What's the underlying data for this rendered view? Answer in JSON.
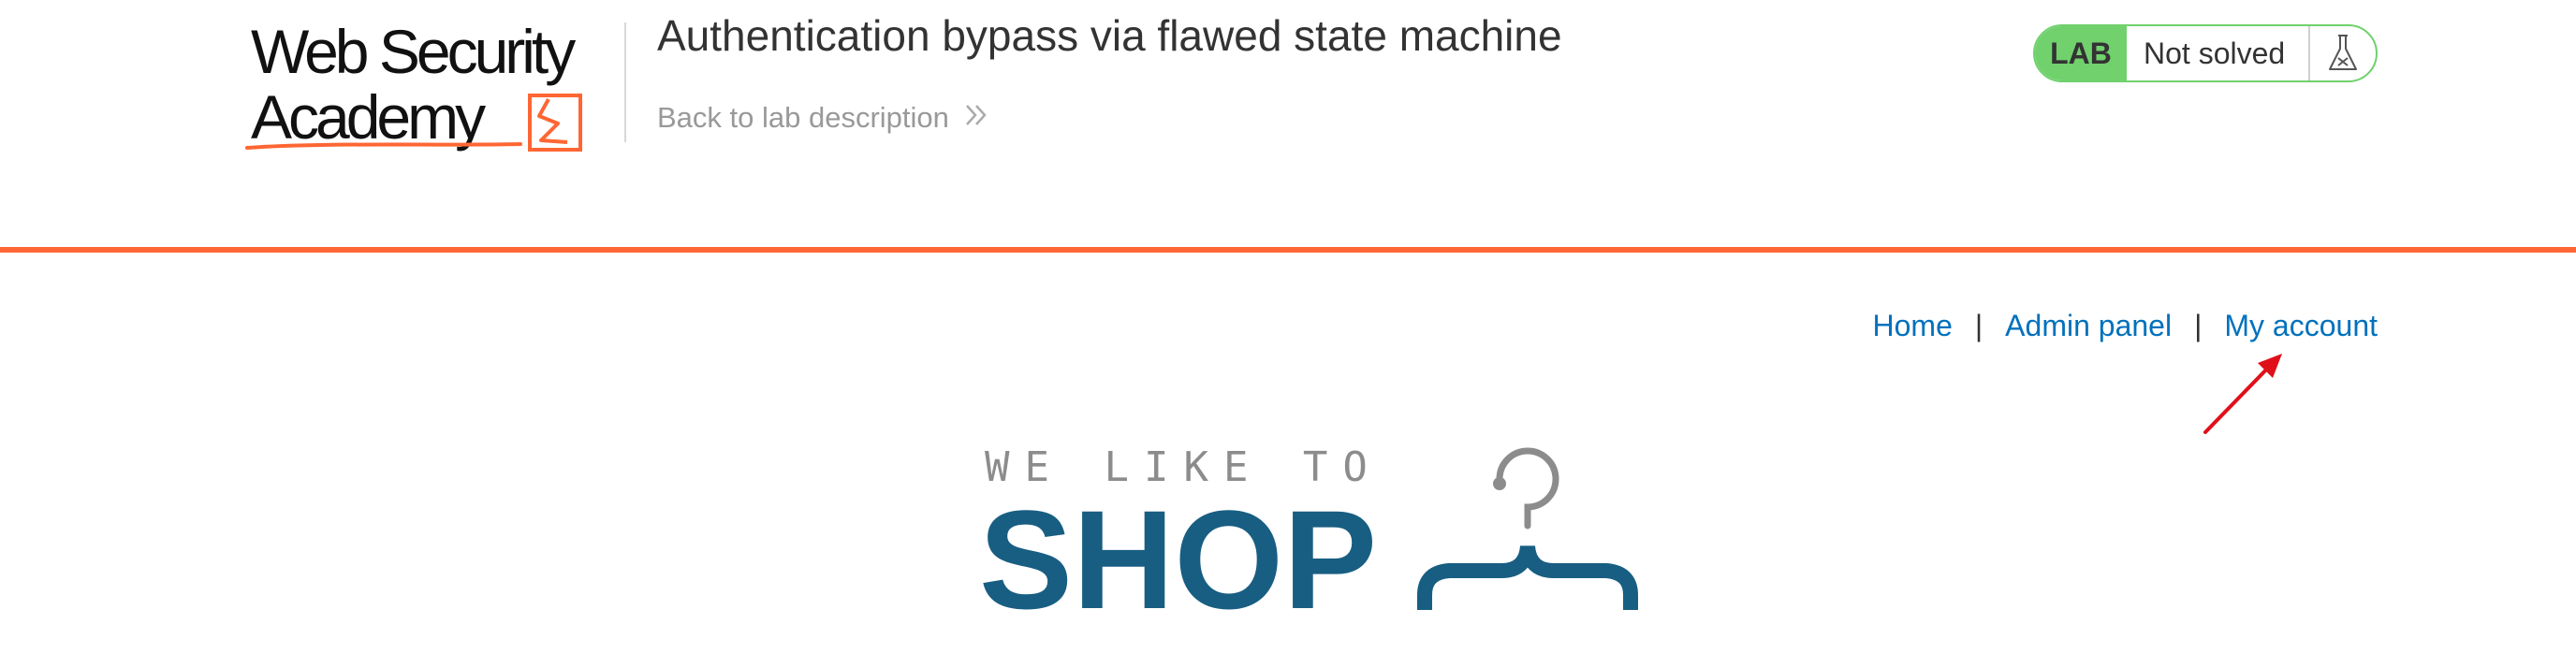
{
  "header": {
    "logo": {
      "line1": "Web Security",
      "line2": "Academy",
      "accent_color": "#ff6633"
    },
    "lab_title": "Authentication bypass via flawed state machine",
    "back_link": "Back to lab description",
    "lab_status": {
      "badge": "LAB",
      "state": "Not solved",
      "icon": "flask-icon",
      "color": "#70d16d"
    }
  },
  "nav": {
    "items": [
      {
        "label": "Home"
      },
      {
        "label": "Admin panel"
      },
      {
        "label": "My account"
      }
    ],
    "separator": "|"
  },
  "shop_logo": {
    "tagline": "WE LIKE TO",
    "word": "SHOP",
    "icon": "hanger-icon",
    "color": "#185e82"
  },
  "annotation": {
    "icon": "red-arrow-icon",
    "color": "#e0101a"
  }
}
